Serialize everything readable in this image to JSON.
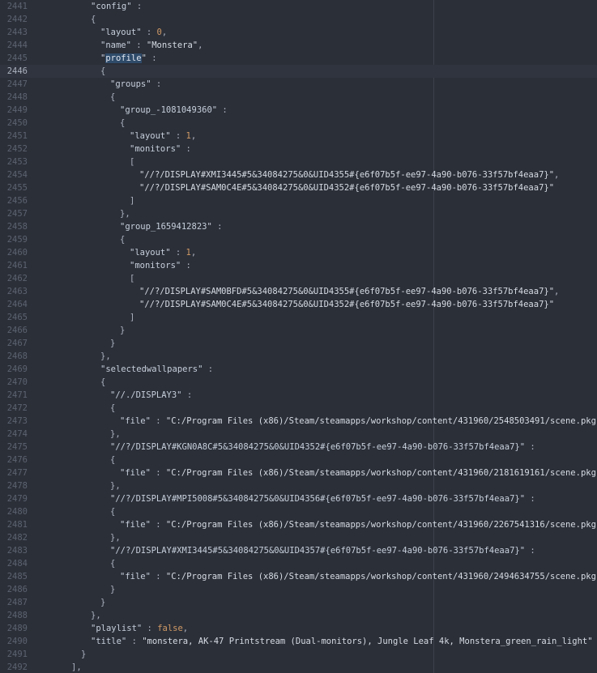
{
  "editor": {
    "current_line": 2446,
    "lines": [
      {
        "n": "2441",
        "indent": 6,
        "tokens": [
          {
            "t": "\"config\"",
            "c": "key"
          },
          {
            "t": " : "
          }
        ]
      },
      {
        "n": "2442",
        "indent": 6,
        "tokens": [
          {
            "t": "{"
          }
        ]
      },
      {
        "n": "2443",
        "indent": 7,
        "tokens": [
          {
            "t": "\"layout\"",
            "c": "key"
          },
          {
            "t": " : "
          },
          {
            "t": "0",
            "c": "num"
          },
          {
            "t": ","
          }
        ]
      },
      {
        "n": "2444",
        "indent": 7,
        "tokens": [
          {
            "t": "\"name\"",
            "c": "key"
          },
          {
            "t": " : "
          },
          {
            "t": "\"Monstera\"",
            "c": "str"
          },
          {
            "t": ","
          }
        ]
      },
      {
        "n": "2445",
        "indent": 7,
        "tokens": [
          {
            "t": "\"",
            "c": "key"
          },
          {
            "t": "profile",
            "c": "hl"
          },
          {
            "t": "\"",
            "c": "key"
          },
          {
            "t": " : "
          }
        ]
      },
      {
        "n": "2446",
        "indent": 7,
        "tokens": [
          {
            "t": "{"
          }
        ]
      },
      {
        "n": "2447",
        "indent": 8,
        "tokens": [
          {
            "t": "\"groups\"",
            "c": "key"
          },
          {
            "t": " : "
          }
        ]
      },
      {
        "n": "2448",
        "indent": 8,
        "tokens": [
          {
            "t": "{"
          }
        ]
      },
      {
        "n": "2449",
        "indent": 9,
        "tokens": [
          {
            "t": "\"group_-1081049360\"",
            "c": "key"
          },
          {
            "t": " : "
          }
        ]
      },
      {
        "n": "2450",
        "indent": 9,
        "tokens": [
          {
            "t": "{"
          }
        ]
      },
      {
        "n": "2451",
        "indent": 10,
        "tokens": [
          {
            "t": "\"layout\"",
            "c": "key"
          },
          {
            "t": " : "
          },
          {
            "t": "1",
            "c": "num"
          },
          {
            "t": ","
          }
        ]
      },
      {
        "n": "2452",
        "indent": 10,
        "tokens": [
          {
            "t": "\"monitors\"",
            "c": "key"
          },
          {
            "t": " : "
          }
        ]
      },
      {
        "n": "2453",
        "indent": 10,
        "tokens": [
          {
            "t": "["
          }
        ]
      },
      {
        "n": "2454",
        "indent": 11,
        "tokens": [
          {
            "t": "\"//?/DISPLAY#XMI3445#5&34084275&0&UID4355#{e6f07b5f-ee97-4a90-b076-33f57bf4eaa7}\"",
            "c": "str"
          },
          {
            "t": ","
          }
        ]
      },
      {
        "n": "2455",
        "indent": 11,
        "tokens": [
          {
            "t": "\"//?/DISPLAY#SAM0C4E#5&34084275&0&UID4352#{e6f07b5f-ee97-4a90-b076-33f57bf4eaa7}\"",
            "c": "str"
          }
        ]
      },
      {
        "n": "2456",
        "indent": 10,
        "tokens": [
          {
            "t": "]"
          }
        ]
      },
      {
        "n": "2457",
        "indent": 9,
        "tokens": [
          {
            "t": "},"
          }
        ]
      },
      {
        "n": "2458",
        "indent": 9,
        "tokens": [
          {
            "t": "\"group_1659412823\"",
            "c": "key"
          },
          {
            "t": " : "
          }
        ]
      },
      {
        "n": "2459",
        "indent": 9,
        "tokens": [
          {
            "t": "{"
          }
        ]
      },
      {
        "n": "2460",
        "indent": 10,
        "tokens": [
          {
            "t": "\"layout\"",
            "c": "key"
          },
          {
            "t": " : "
          },
          {
            "t": "1",
            "c": "num"
          },
          {
            "t": ","
          }
        ]
      },
      {
        "n": "2461",
        "indent": 10,
        "tokens": [
          {
            "t": "\"monitors\"",
            "c": "key"
          },
          {
            "t": " : "
          }
        ]
      },
      {
        "n": "2462",
        "indent": 10,
        "tokens": [
          {
            "t": "["
          }
        ]
      },
      {
        "n": "2463",
        "indent": 11,
        "tokens": [
          {
            "t": "\"//?/DISPLAY#SAM0BFD#5&34084275&0&UID4355#{e6f07b5f-ee97-4a90-b076-33f57bf4eaa7}\"",
            "c": "str"
          },
          {
            "t": ","
          }
        ]
      },
      {
        "n": "2464",
        "indent": 11,
        "tokens": [
          {
            "t": "\"//?/DISPLAY#SAM0C4E#5&34084275&0&UID4352#{e6f07b5f-ee97-4a90-b076-33f57bf4eaa7}\"",
            "c": "str"
          }
        ]
      },
      {
        "n": "2465",
        "indent": 10,
        "tokens": [
          {
            "t": "]"
          }
        ]
      },
      {
        "n": "2466",
        "indent": 9,
        "tokens": [
          {
            "t": "}"
          }
        ]
      },
      {
        "n": "2467",
        "indent": 8,
        "tokens": [
          {
            "t": "}"
          }
        ]
      },
      {
        "n": "2468",
        "indent": 7,
        "tokens": [
          {
            "t": "},"
          }
        ]
      },
      {
        "n": "2469",
        "indent": 7,
        "tokens": [
          {
            "t": "\"selectedwallpapers\"",
            "c": "key"
          },
          {
            "t": " : "
          }
        ]
      },
      {
        "n": "2470",
        "indent": 7,
        "tokens": [
          {
            "t": "{"
          }
        ]
      },
      {
        "n": "2471",
        "indent": 8,
        "tokens": [
          {
            "t": "\"//./DISPLAY3\"",
            "c": "key"
          },
          {
            "t": " : "
          }
        ]
      },
      {
        "n": "2472",
        "indent": 8,
        "tokens": [
          {
            "t": "{"
          }
        ]
      },
      {
        "n": "2473",
        "indent": 9,
        "tokens": [
          {
            "t": "\"file\"",
            "c": "key"
          },
          {
            "t": " : "
          },
          {
            "t": "\"C:/Program Files (x86)/Steam/steamapps/workshop/content/431960/2548503491/scene.pkg\"",
            "c": "str"
          }
        ]
      },
      {
        "n": "2474",
        "indent": 8,
        "tokens": [
          {
            "t": "},"
          }
        ]
      },
      {
        "n": "2475",
        "indent": 8,
        "tokens": [
          {
            "t": "\"//?/DISPLAY#KGN0A8C#5&34084275&0&UID4352#{e6f07b5f-ee97-4a90-b076-33f57bf4eaa7}\"",
            "c": "key"
          },
          {
            "t": " : "
          }
        ]
      },
      {
        "n": "2476",
        "indent": 8,
        "tokens": [
          {
            "t": "{"
          }
        ]
      },
      {
        "n": "2477",
        "indent": 9,
        "tokens": [
          {
            "t": "\"file\"",
            "c": "key"
          },
          {
            "t": " : "
          },
          {
            "t": "\"C:/Program Files (x86)/Steam/steamapps/workshop/content/431960/2181619161/scene.pkg\"",
            "c": "str"
          }
        ]
      },
      {
        "n": "2478",
        "indent": 8,
        "tokens": [
          {
            "t": "},"
          }
        ]
      },
      {
        "n": "2479",
        "indent": 8,
        "tokens": [
          {
            "t": "\"//?/DISPLAY#MPI5008#5&34084275&0&UID4356#{e6f07b5f-ee97-4a90-b076-33f57bf4eaa7}\"",
            "c": "key"
          },
          {
            "t": " : "
          }
        ]
      },
      {
        "n": "2480",
        "indent": 8,
        "tokens": [
          {
            "t": "{"
          }
        ]
      },
      {
        "n": "2481",
        "indent": 9,
        "tokens": [
          {
            "t": "\"file\"",
            "c": "key"
          },
          {
            "t": " : "
          },
          {
            "t": "\"C:/Program Files (x86)/Steam/steamapps/workshop/content/431960/2267541316/scene.pkg\"",
            "c": "str"
          }
        ]
      },
      {
        "n": "2482",
        "indent": 8,
        "tokens": [
          {
            "t": "},"
          }
        ]
      },
      {
        "n": "2483",
        "indent": 8,
        "tokens": [
          {
            "t": "\"//?/DISPLAY#XMI3445#5&34084275&0&UID4357#{e6f07b5f-ee97-4a90-b076-33f57bf4eaa7}\"",
            "c": "key"
          },
          {
            "t": " : "
          }
        ]
      },
      {
        "n": "2484",
        "indent": 8,
        "tokens": [
          {
            "t": "{"
          }
        ]
      },
      {
        "n": "2485",
        "indent": 9,
        "tokens": [
          {
            "t": "\"file\"",
            "c": "key"
          },
          {
            "t": " : "
          },
          {
            "t": "\"C:/Program Files (x86)/Steam/steamapps/workshop/content/431960/2494634755/scene.pkg\"",
            "c": "str"
          }
        ]
      },
      {
        "n": "2486",
        "indent": 8,
        "tokens": [
          {
            "t": "}"
          }
        ]
      },
      {
        "n": "2487",
        "indent": 7,
        "tokens": [
          {
            "t": "}"
          }
        ]
      },
      {
        "n": "2488",
        "indent": 6,
        "tokens": [
          {
            "t": "},"
          }
        ]
      },
      {
        "n": "2489",
        "indent": 6,
        "tokens": [
          {
            "t": "\"playlist\"",
            "c": "key"
          },
          {
            "t": " : "
          },
          {
            "t": "false",
            "c": "bool"
          },
          {
            "t": ","
          }
        ]
      },
      {
        "n": "2490",
        "indent": 6,
        "tokens": [
          {
            "t": "\"title\"",
            "c": "key"
          },
          {
            "t": " : "
          },
          {
            "t": "\"monstera, AK-47 Printstream (Dual-monitors), Jungle Leaf 4k, Monstera_green_rain_light\"",
            "c": "str"
          }
        ]
      },
      {
        "n": "2491",
        "indent": 5,
        "tokens": [
          {
            "t": "}"
          }
        ]
      },
      {
        "n": "2492",
        "indent": 4,
        "tokens": [
          {
            "t": "],"
          }
        ]
      }
    ]
  }
}
